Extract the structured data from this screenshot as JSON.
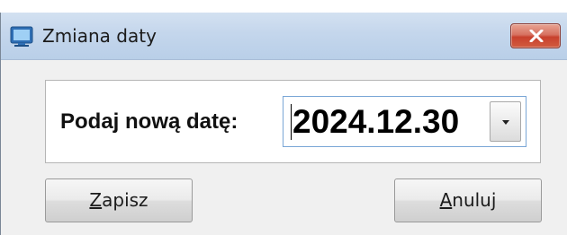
{
  "window": {
    "title": "Zmiana daty"
  },
  "form": {
    "prompt_label": "Podaj nową datę:",
    "date_value": "2024.12.30"
  },
  "buttons": {
    "save": {
      "mnemonic": "Z",
      "rest": "apisz"
    },
    "cancel": {
      "mnemonic": "A",
      "rest": "nuluj"
    }
  },
  "icons": {
    "app": "app-window-icon",
    "close": "close-icon",
    "dropdown": "chevron-down-icon"
  },
  "colors": {
    "titlebar": "#c4d6ec",
    "close": "#c8412d",
    "focus_border": "#7aa6d6"
  }
}
